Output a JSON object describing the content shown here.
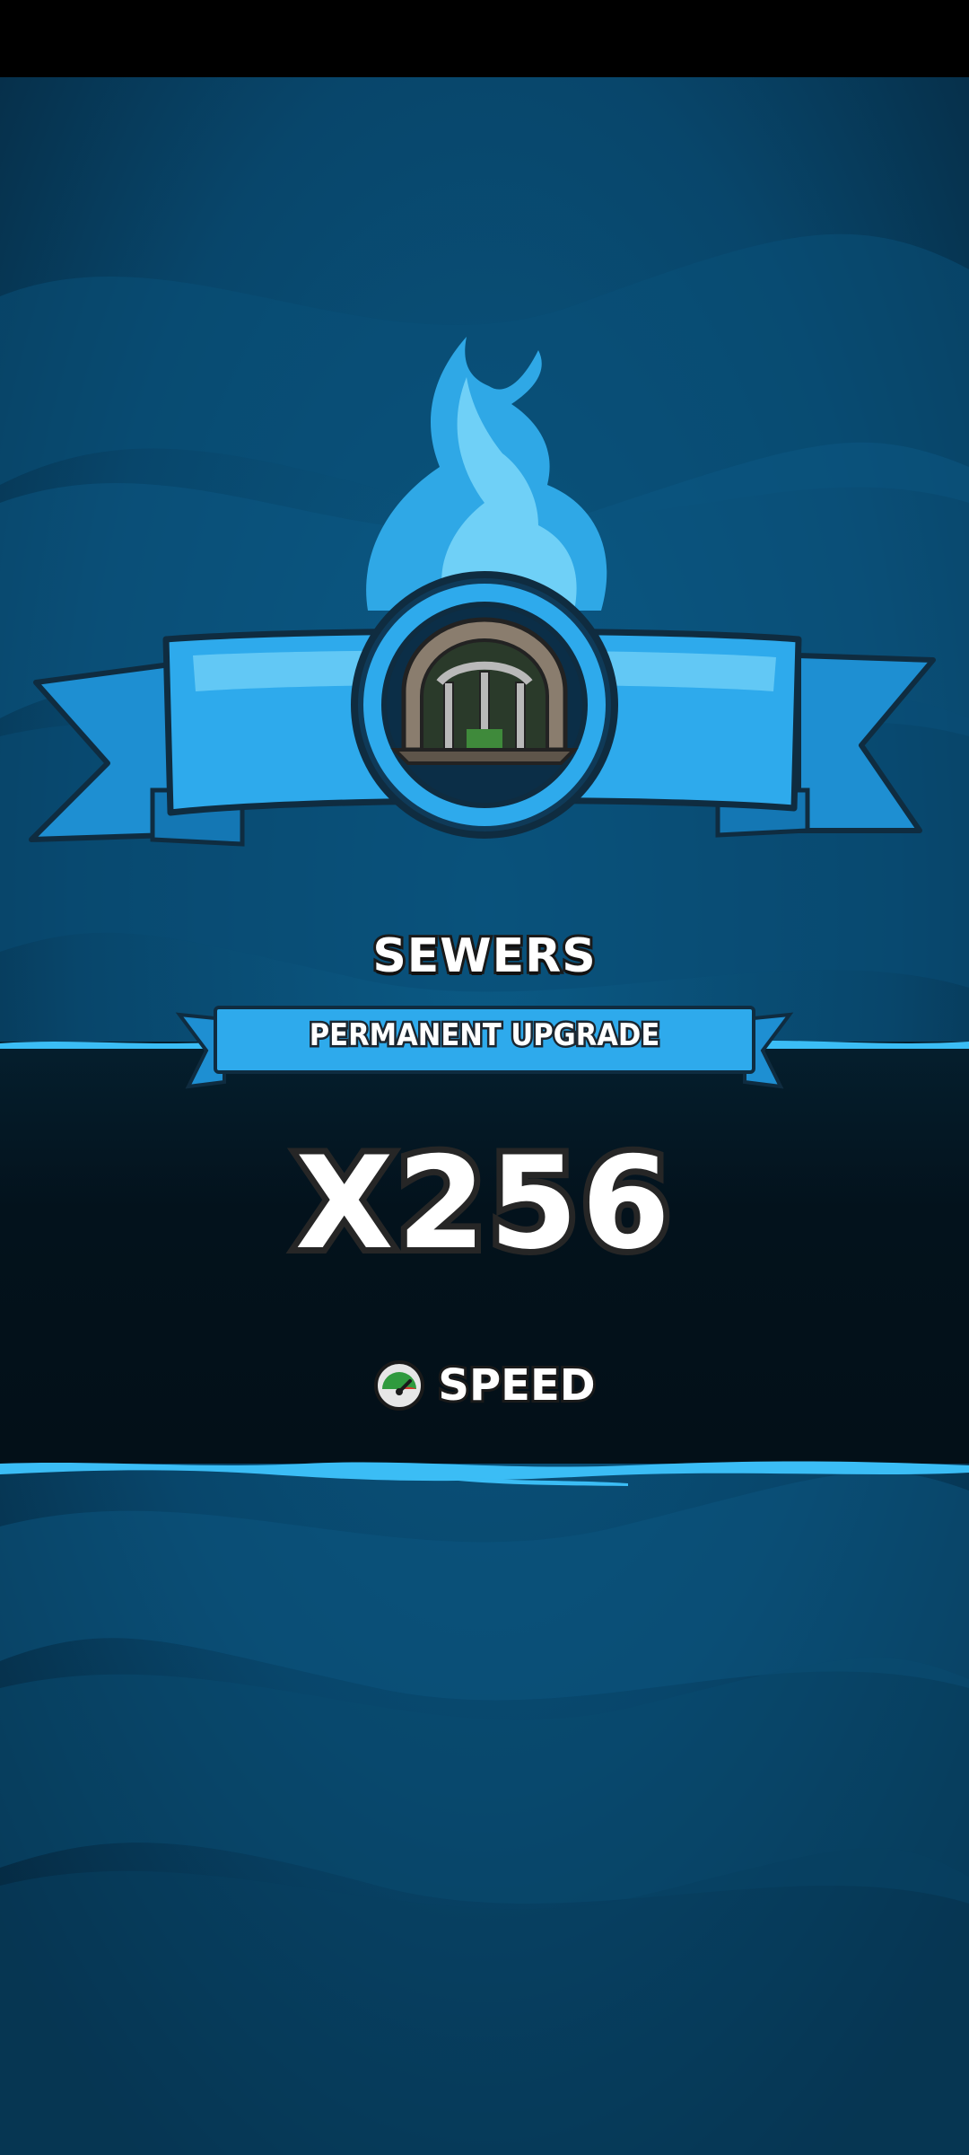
{
  "reward": {
    "location_name": "SEWERS",
    "upgrade_type": "PERMANENT UPGRADE",
    "multiplier": "X256",
    "stat_name": "SPEED"
  },
  "icons": {
    "location": "sewer-grate-icon",
    "stat": "speedometer-icon",
    "decoration": "blue-flame-icon"
  },
  "colors": {
    "background": "#0a4a6e",
    "ribbon": "#2aa6e8",
    "flame": "#3cb8f0",
    "dark_band": "#031018",
    "text": "#ffffff"
  }
}
